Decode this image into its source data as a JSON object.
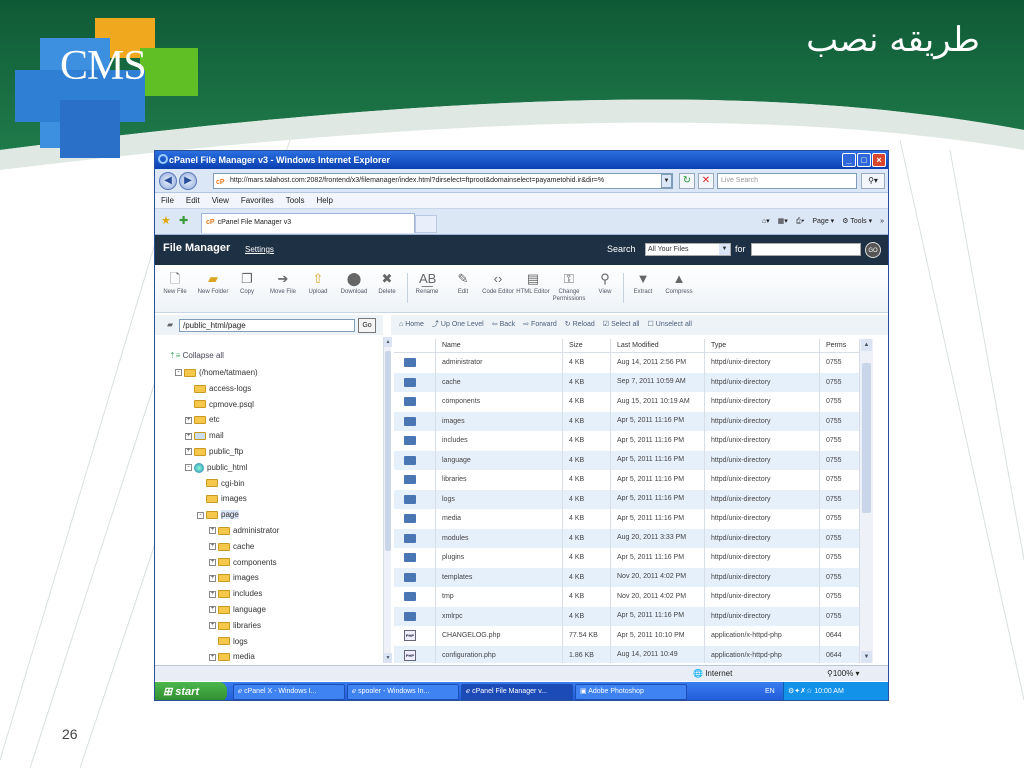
{
  "slide": {
    "title": "طريقه نصب",
    "logo_text": "CMS",
    "page_number": "26"
  },
  "browser": {
    "title": "cPanel File Manager v3 - Windows Internet Explorer",
    "address": "http://mars.talahost.com:2082/frontend/x3/filemanager/index.html?dirselect=ftproot&domainselect=payametohid.ir&dir=%",
    "search_placeholder": "Live Search",
    "menu": [
      "File",
      "Edit",
      "View",
      "Favorites",
      "Tools",
      "Help"
    ],
    "tab_label": "cPanel File Manager v3",
    "cmd_page": "Page",
    "cmd_tools": "Tools"
  },
  "fm": {
    "title": "File Manager",
    "settings": "Settings",
    "search_label": "Search",
    "search_scope": "All Your Files",
    "for_label": "for",
    "go": "GO",
    "toolbar": [
      "New File",
      "New Folder",
      "Copy",
      "Move File",
      "Upload",
      "Download",
      "Delete",
      "Rename",
      "Edit",
      "Code Editor",
      "HTML Editor",
      "Change Permissions",
      "View",
      "Extract",
      "Compress"
    ],
    "path_value": "/public_html/page",
    "path_go": "Go",
    "actions": [
      "Home",
      "Up One Level",
      "Back",
      "Forward",
      "Reload",
      "Select all",
      "Unselect all"
    ],
    "collapse_all": "Collapse all",
    "tree": [
      {
        "label": "(/home/tatmaen)",
        "level": 0,
        "pm": "-",
        "icon": "home"
      },
      {
        "label": "access-logs",
        "level": 1,
        "pm": "",
        "icon": "folder"
      },
      {
        "label": "cpmove.psql",
        "level": 1,
        "pm": "",
        "icon": "folder"
      },
      {
        "label": "etc",
        "level": 1,
        "pm": "+",
        "icon": "folder"
      },
      {
        "label": "mail",
        "level": 1,
        "pm": "+",
        "icon": "mail"
      },
      {
        "label": "public_ftp",
        "level": 1,
        "pm": "+",
        "icon": "ftp"
      },
      {
        "label": "public_html",
        "level": 1,
        "pm": "-",
        "icon": "globe"
      },
      {
        "label": "cgi-bin",
        "level": 2,
        "pm": "",
        "icon": "folder"
      },
      {
        "label": "images",
        "level": 2,
        "pm": "",
        "icon": "folder"
      },
      {
        "label": "page",
        "level": 2,
        "pm": "-",
        "icon": "folder",
        "selected": true
      },
      {
        "label": "administrator",
        "level": 3,
        "pm": "+",
        "icon": "folder"
      },
      {
        "label": "cache",
        "level": 3,
        "pm": "+",
        "icon": "folder"
      },
      {
        "label": "components",
        "level": 3,
        "pm": "+",
        "icon": "folder"
      },
      {
        "label": "images",
        "level": 3,
        "pm": "+",
        "icon": "folder"
      },
      {
        "label": "includes",
        "level": 3,
        "pm": "+",
        "icon": "folder"
      },
      {
        "label": "language",
        "level": 3,
        "pm": "+",
        "icon": "folder"
      },
      {
        "label": "libraries",
        "level": 3,
        "pm": "+",
        "icon": "folder"
      },
      {
        "label": "logs",
        "level": 3,
        "pm": "",
        "icon": "folder"
      },
      {
        "label": "media",
        "level": 3,
        "pm": "+",
        "icon": "folder"
      }
    ],
    "columns": [
      "Name",
      "Size",
      "Last Modified",
      "Type",
      "Perms"
    ],
    "files": [
      {
        "icon": "folder",
        "name": "administrator",
        "size": "4 KB",
        "modified": "Aug 14, 2011 2:56 PM",
        "type": "httpd/unix-directory",
        "perms": "0755"
      },
      {
        "icon": "folder",
        "name": "cache",
        "size": "4 KB",
        "modified": "Sep 7, 2011 10:59 AM",
        "type": "httpd/unix-directory",
        "perms": "0755"
      },
      {
        "icon": "folder",
        "name": "components",
        "size": "4 KB",
        "modified": "Aug 15, 2011 10:19 AM",
        "type": "httpd/unix-directory",
        "perms": "0755"
      },
      {
        "icon": "folder",
        "name": "images",
        "size": "4 KB",
        "modified": "Apr 5, 2011 11:16 PM",
        "type": "httpd/unix-directory",
        "perms": "0755"
      },
      {
        "icon": "folder",
        "name": "includes",
        "size": "4 KB",
        "modified": "Apr 5, 2011 11:16 PM",
        "type": "httpd/unix-directory",
        "perms": "0755"
      },
      {
        "icon": "folder",
        "name": "language",
        "size": "4 KB",
        "modified": "Apr 5, 2011 11:16 PM",
        "type": "httpd/unix-directory",
        "perms": "0755"
      },
      {
        "icon": "folder",
        "name": "libraries",
        "size": "4 KB",
        "modified": "Apr 5, 2011 11:16 PM",
        "type": "httpd/unix-directory",
        "perms": "0755"
      },
      {
        "icon": "folder",
        "name": "logs",
        "size": "4 KB",
        "modified": "Apr 5, 2011 11:16 PM",
        "type": "httpd/unix-directory",
        "perms": "0755"
      },
      {
        "icon": "folder",
        "name": "media",
        "size": "4 KB",
        "modified": "Apr 5, 2011 11:16 PM",
        "type": "httpd/unix-directory",
        "perms": "0755"
      },
      {
        "icon": "folder",
        "name": "modules",
        "size": "4 KB",
        "modified": "Aug 20, 2011 3:33 PM",
        "type": "httpd/unix-directory",
        "perms": "0755"
      },
      {
        "icon": "folder",
        "name": "plugins",
        "size": "4 KB",
        "modified": "Apr 5, 2011 11:16 PM",
        "type": "httpd/unix-directory",
        "perms": "0755"
      },
      {
        "icon": "folder",
        "name": "templates",
        "size": "4 KB",
        "modified": "Nov 20, 2011 4:02 PM",
        "type": "httpd/unix-directory",
        "perms": "0755"
      },
      {
        "icon": "folder",
        "name": "tmp",
        "size": "4 KB",
        "modified": "Nov 20, 2011 4:02 PM",
        "type": "httpd/unix-directory",
        "perms": "0755"
      },
      {
        "icon": "folder",
        "name": "xmlrpc",
        "size": "4 KB",
        "modified": "Apr 5, 2011 11:16 PM",
        "type": "httpd/unix-directory",
        "perms": "0755"
      },
      {
        "icon": "php",
        "name": "CHANGELOG.php",
        "size": "77.54 KB",
        "modified": "Apr 5, 2011 10:10 PM",
        "type": "application/x-httpd-php",
        "perms": "0644"
      },
      {
        "icon": "php",
        "name": "configuration.php",
        "size": "1.86 KB",
        "modified": "Aug 14, 2011 10:49",
        "type": "application/x-httpd-php",
        "perms": "0644"
      }
    ]
  },
  "status": {
    "zone": "Internet",
    "zoom": "100%"
  },
  "taskbar": {
    "start": "start",
    "tasks": [
      "cPanel X - Windows I...",
      "spooler - Windows In...",
      "cPanel File Manager v...",
      "Adobe Photoshop"
    ],
    "lang": "EN",
    "clock": "10:00 AM"
  }
}
